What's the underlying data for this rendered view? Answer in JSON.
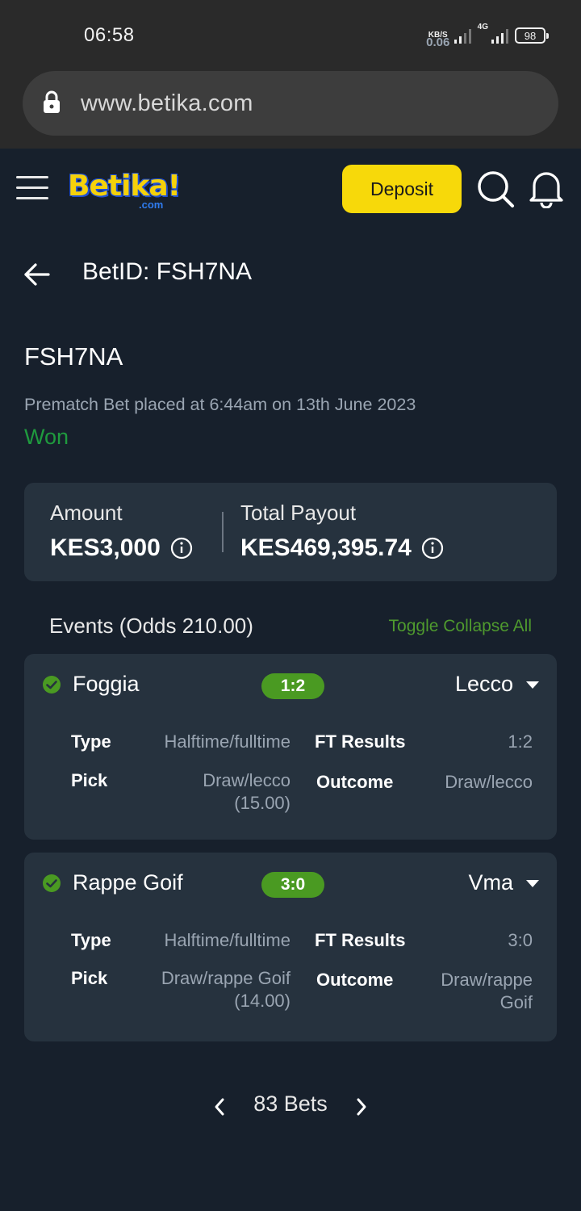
{
  "statusbar": {
    "time": "06:58",
    "net_speed_value": "0.06",
    "net_speed_unit": "KB/S",
    "network_type": "4G",
    "battery": "98"
  },
  "browser": {
    "url": "www.betika.com"
  },
  "header": {
    "logo_text": "Betika!",
    "logo_sub": ".com",
    "deposit_label": "Deposit"
  },
  "page": {
    "title": "BetID: FSH7NA",
    "bet_code": "FSH7NA",
    "placed_text": "Prematch Bet placed at 6:44am on 13th June 2023",
    "status": "Won"
  },
  "summary": {
    "amount_label": "Amount",
    "amount_value": "KES3,000",
    "payout_label": "Total Payout",
    "payout_value": "KES469,395.74"
  },
  "events": {
    "header": "Events (Odds 210.00)",
    "toggle_label": "Toggle Collapse All",
    "items": [
      {
        "home": "Foggia",
        "score": "1:2",
        "away": "Lecco",
        "type_label": "Type",
        "type_value": "Halftime/fulltime",
        "ft_label": "FT Results",
        "ft_value": "1:2",
        "pick_label": "Pick",
        "pick_value_1": "Draw/lecco",
        "pick_value_2": "(15.00)",
        "outcome_label": "Outcome",
        "outcome_value_1": "Draw/lecco",
        "outcome_value_2": ""
      },
      {
        "home": "Rappe Goif",
        "score": "3:0",
        "away": "Vma",
        "type_label": "Type",
        "type_value": "Halftime/fulltime",
        "ft_label": "FT Results",
        "ft_value": "3:0",
        "pick_label": "Pick",
        "pick_value_1": "Draw/rappe Goif",
        "pick_value_2": "(14.00)",
        "outcome_label": "Outcome",
        "outcome_value_1": "Draw/rappe",
        "outcome_value_2": "Goif"
      }
    ]
  },
  "pagination": {
    "label": "83 Bets"
  },
  "colors": {
    "background": "#17202c",
    "card": "#26323e",
    "accent_yellow": "#f7d90a",
    "won_green": "#1f9a3e",
    "pill_green": "#4a9a22"
  }
}
